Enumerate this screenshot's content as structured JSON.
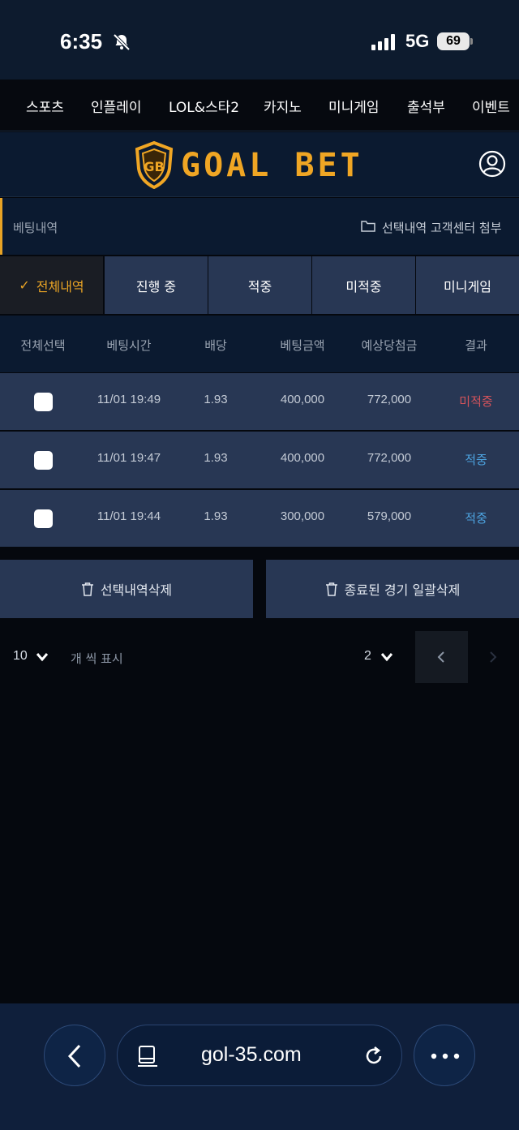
{
  "status_bar": {
    "time": "6:35",
    "network": "5G",
    "battery": "69"
  },
  "nav": {
    "items": [
      "스포츠",
      "인플레이",
      "LOL&스타2",
      "카지노",
      "미니게임",
      "출석부",
      "이벤트"
    ]
  },
  "header": {
    "logo_text": "GOAL BET",
    "logo_mark": "GB"
  },
  "breadcrumb": {
    "title": "베팅내역",
    "links": "선택내역 고객센터 첨부"
  },
  "tabs": [
    {
      "label": "전체내역",
      "active": true
    },
    {
      "label": "진행 중",
      "active": false
    },
    {
      "label": "적중",
      "active": false
    },
    {
      "label": "미적중",
      "active": false
    },
    {
      "label": "미니게임",
      "active": false
    }
  ],
  "table": {
    "headers": [
      "전체선택",
      "베팅시간",
      "배당",
      "베팅금액",
      "예상당첨금",
      "결과"
    ],
    "rows": [
      {
        "time": "11/01 19:49",
        "odds": "1.93",
        "amount": "400,000",
        "expected": "772,000",
        "result": "미적중"
      },
      {
        "time": "11/01 19:47",
        "odds": "1.93",
        "amount": "400,000",
        "expected": "772,000",
        "result": "적중"
      },
      {
        "time": "11/01 19:44",
        "odds": "1.93",
        "amount": "300,000",
        "expected": "579,000",
        "result": "적중"
      }
    ]
  },
  "actions": {
    "delete_selected": "선택내역삭제",
    "delete_finished": "종료된 경기 일괄삭제"
  },
  "pagination": {
    "per_page": "10",
    "per_page_label": "개 씩 표시",
    "page": "2"
  },
  "browser": {
    "url": "gol-35.com"
  },
  "colors": {
    "accent": "#e8a325",
    "win": "#4da3e0",
    "lose": "#d4535b"
  }
}
